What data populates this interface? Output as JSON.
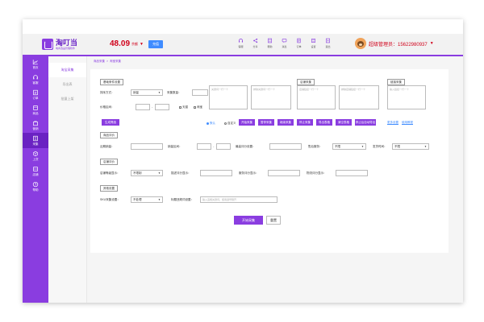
{
  "header": {
    "logo_title": "淘叮当",
    "logo_subtitle": "电商选品管理软件",
    "balance": "48.09",
    "balance_unit": "余额",
    "recharge_label": "充值",
    "user_name": "超级管理员：15622980937",
    "tools": [
      {
        "label": "客服",
        "icon": "headset-icon"
      },
      {
        "label": "分享",
        "icon": "share-icon"
      },
      {
        "label": "帮助",
        "icon": "book-icon"
      },
      {
        "label": "消息",
        "icon": "message-icon"
      },
      {
        "label": "订单",
        "icon": "order-icon"
      },
      {
        "label": "设置",
        "icon": "settings-icon"
      },
      {
        "label": "退出",
        "icon": "logout-icon"
      }
    ]
  },
  "sidebar": {
    "items": [
      {
        "label": "首页",
        "icon": "chart-icon"
      },
      {
        "label": "客服",
        "icon": "headset-icon"
      },
      {
        "label": "订单",
        "icon": "document-icon"
      },
      {
        "label": "商品",
        "icon": "box-icon"
      },
      {
        "label": "营销",
        "icon": "bag-icon"
      },
      {
        "label": "采集",
        "icon": "collect-icon"
      },
      {
        "label": "上货",
        "icon": "upload-icon"
      },
      {
        "label": "店铺",
        "icon": "store-icon"
      },
      {
        "label": "帮助",
        "icon": "question-icon"
      }
    ]
  },
  "submenu": {
    "items": [
      "淘宝采集",
      "导出表",
      "批量上架"
    ]
  },
  "breadcrumb": [
    "商品采集",
    ">",
    "淘宝采集"
  ],
  "form": {
    "section_basic": "基础条件设置",
    "sort_label": "排序方式：",
    "sort_value": "销量",
    "count_label": "采集数量：",
    "price_label": "价格区间：",
    "tmall_label": "天猫",
    "taobao_label": "淘宝",
    "keyword_placeholder": "关键词一行一个",
    "exclude_placeholder": "排除关键词一行一个",
    "section_shop": "店铺采集",
    "shop_placeholder": "店铺链接一行一个",
    "shop_exclude_placeholder": "排除店铺链接一行一个",
    "section_link": "链接采集",
    "link_placeholder": "输入链接一行一个",
    "filter_btn": "生成筛选",
    "radio_items": [
      "默认",
      "自定义"
    ],
    "action_buttons": [
      "开始采集",
      "暂停采集",
      "继续采集",
      "停止采集",
      "导出表格",
      "清空表格",
      "停止后自动导出"
    ],
    "more_link": "更多设置",
    "help_link": "使用教程",
    "section_goods": "商品评价",
    "sales_label": "近期销量：",
    "period_label": "销量区间：",
    "shop_rating_label": "最高评分设置：",
    "tab_label": "售后服务：",
    "tab_value": "不限",
    "ship_label": "发货时间：",
    "ship_value": "不限",
    "section_store": "店铺评价",
    "store_level_label": "店铺等级显示：",
    "store_level_value": "不限制",
    "desc_label": "描述评分显示：",
    "service_label": "服务评分显示：",
    "logistics_label": "物流评分显示：",
    "section_other": "其他设置",
    "sku_label": "SKU采集设置：",
    "sku_value": "不处理",
    "title_label": "标题违规词设置：",
    "title_placeholder": "输入违规关键词，使用逗号隔开",
    "start_btn": "开始采集",
    "reset_btn": "重置"
  },
  "colors": {
    "accent": "#8a3de0",
    "price": "#d0021b",
    "link": "#3f8cff"
  }
}
